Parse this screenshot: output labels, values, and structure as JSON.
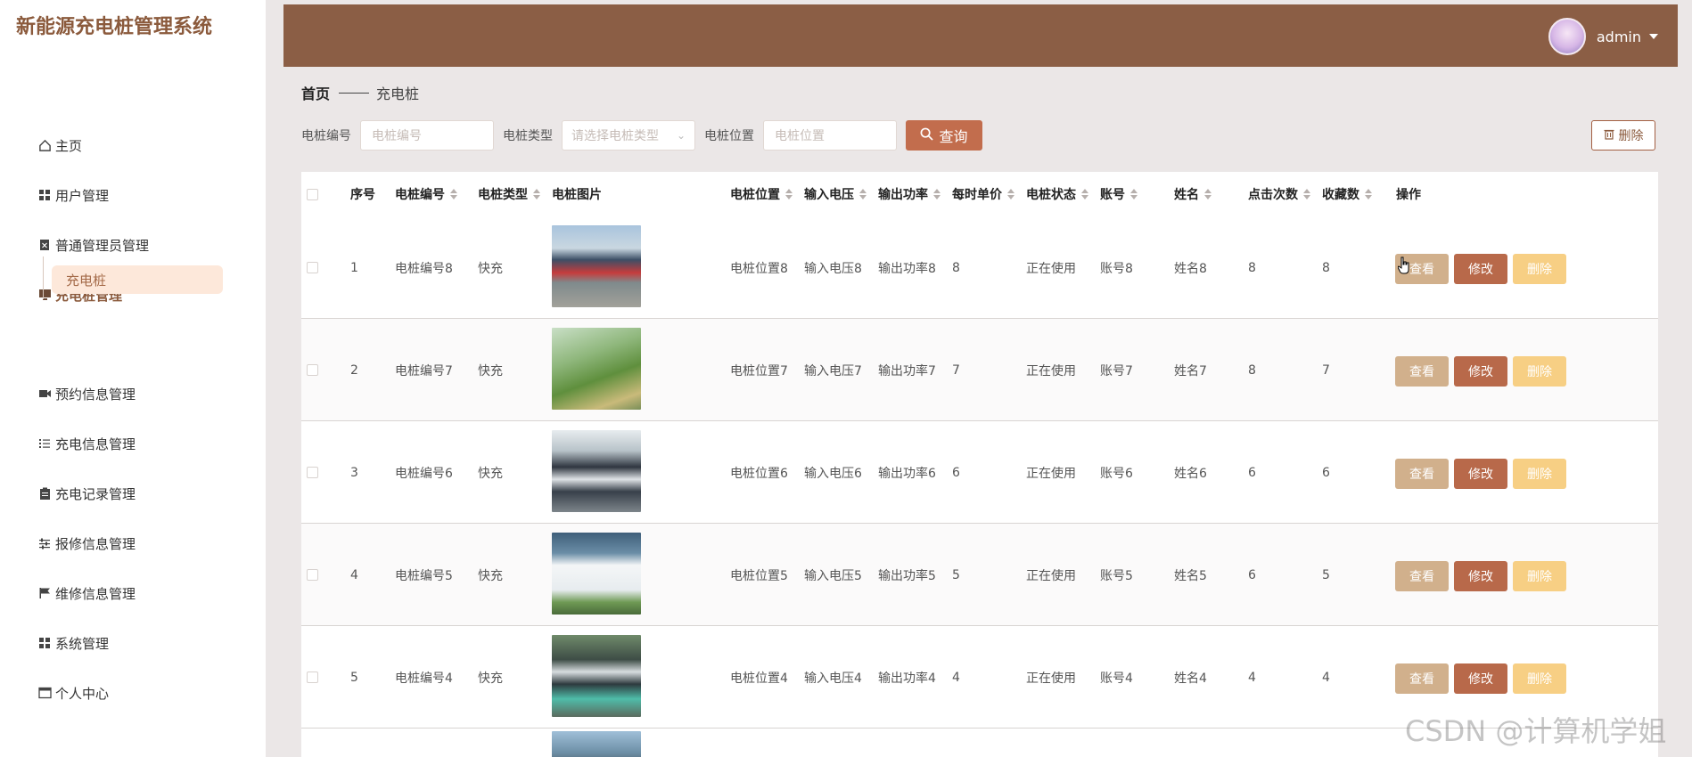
{
  "brand": "新能源充电桩管理系统",
  "sidebar": {
    "items": [
      {
        "label": "主页",
        "icon": "home-icon"
      },
      {
        "label": "用户管理",
        "icon": "grid-icon"
      },
      {
        "label": "普通管理员管理",
        "icon": "clipboard-x-icon"
      },
      {
        "label": "充电桩管理",
        "icon": "monitor-icon"
      },
      {
        "label": "预约信息管理",
        "icon": "video-icon"
      },
      {
        "label": "充电信息管理",
        "icon": "list-icon"
      },
      {
        "label": "充电记录管理",
        "icon": "clipboard-icon"
      },
      {
        "label": "报修信息管理",
        "icon": "sliders-icon"
      },
      {
        "label": "维修信息管理",
        "icon": "flag-icon"
      },
      {
        "label": "系统管理",
        "icon": "grid-icon"
      },
      {
        "label": "个人中心",
        "icon": "window-icon"
      }
    ],
    "submenu_active": "充电桩"
  },
  "header": {
    "username": "admin"
  },
  "breadcrumb": {
    "home": "首页",
    "current": "充电桩"
  },
  "search": {
    "pile_no_label": "电桩编号",
    "pile_no_placeholder": "电桩编号",
    "type_label": "电桩类型",
    "type_placeholder": "请选择电桩类型",
    "location_label": "电桩位置",
    "location_placeholder": "电桩位置",
    "query_label": "查询",
    "delete_label": "删除"
  },
  "table": {
    "headers": {
      "index": "序号",
      "pile_no": "电桩编号",
      "pile_type": "电桩类型",
      "pile_image": "电桩图片",
      "location": "电桩位置",
      "input_voltage": "输入电压",
      "output_power": "输出功率",
      "hourly_price": "每时单价",
      "status": "电桩状态",
      "account": "账号",
      "name": "姓名",
      "clicks": "点击次数",
      "favorites": "收藏数",
      "actions": "操作"
    },
    "rows": [
      {
        "index": "1",
        "pile_no": "电桩编号8",
        "pile_type": "快充",
        "location": "电桩位置8",
        "input_voltage": "输入电压8",
        "output_power": "输出功率8",
        "hourly_price": "8",
        "status": "正在使用",
        "account": "账号8",
        "name": "姓名8",
        "clicks": "8",
        "favorites": "8"
      },
      {
        "index": "2",
        "pile_no": "电桩编号7",
        "pile_type": "快充",
        "location": "电桩位置7",
        "input_voltage": "输入电压7",
        "output_power": "输出功率7",
        "hourly_price": "7",
        "status": "正在使用",
        "account": "账号7",
        "name": "姓名7",
        "clicks": "8",
        "favorites": "7"
      },
      {
        "index": "3",
        "pile_no": "电桩编号6",
        "pile_type": "快充",
        "location": "电桩位置6",
        "input_voltage": "输入电压6",
        "output_power": "输出功率6",
        "hourly_price": "6",
        "status": "正在使用",
        "account": "账号6",
        "name": "姓名6",
        "clicks": "6",
        "favorites": "6"
      },
      {
        "index": "4",
        "pile_no": "电桩编号5",
        "pile_type": "快充",
        "location": "电桩位置5",
        "input_voltage": "输入电压5",
        "output_power": "输出功率5",
        "hourly_price": "5",
        "status": "正在使用",
        "account": "账号5",
        "name": "姓名5",
        "clicks": "6",
        "favorites": "5"
      },
      {
        "index": "5",
        "pile_no": "电桩编号4",
        "pile_type": "快充",
        "location": "电桩位置4",
        "input_voltage": "输入电压4",
        "output_power": "输出功率4",
        "hourly_price": "4",
        "status": "正在使用",
        "account": "账号4",
        "name": "姓名4",
        "clicks": "4",
        "favorites": "4"
      }
    ],
    "action_labels": {
      "view": "查看",
      "edit": "修改",
      "delete": "删除"
    }
  },
  "watermark": "CSDN @计算机学姐",
  "colors": {
    "brand": "#8b5a3c",
    "header_bg": "#8b5e45",
    "query_button": "#c26d4d",
    "view_button": "#d1b08c",
    "edit_button": "#b8694a",
    "delete_button": "#f7cf84",
    "active_submenu_bg": "#fde8da"
  }
}
